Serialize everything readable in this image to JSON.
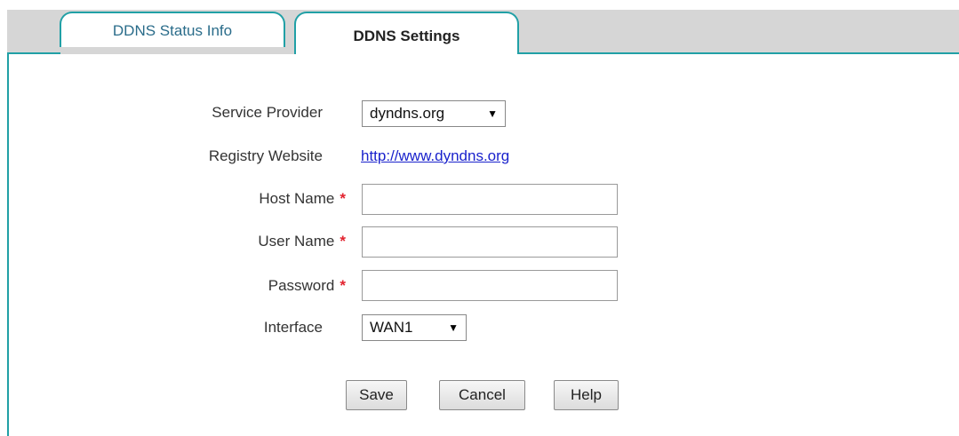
{
  "tabs": [
    {
      "label": "DDNS Status Info",
      "active": false
    },
    {
      "label": "DDNS Settings",
      "active": true
    }
  ],
  "form": {
    "service_provider": {
      "label": "Service Provider",
      "value": "dyndns.org"
    },
    "registry_website": {
      "label": "Registry Website",
      "link": "http://www.dyndns.org"
    },
    "host_name": {
      "label": "Host Name",
      "required_mark": "*",
      "value": ""
    },
    "user_name": {
      "label": "User Name",
      "required_mark": "*",
      "value": ""
    },
    "password": {
      "label": "Password",
      "required_mark": "*",
      "value": ""
    },
    "interface": {
      "label": "Interface",
      "value": "WAN1"
    }
  },
  "buttons": {
    "save": "Save",
    "cancel": "Cancel",
    "help": "Help"
  },
  "colors": {
    "accent": "#21a0a6",
    "required": "#e2222e",
    "link": "#1a22cc",
    "tabbar_bg": "#d6d6d6"
  }
}
